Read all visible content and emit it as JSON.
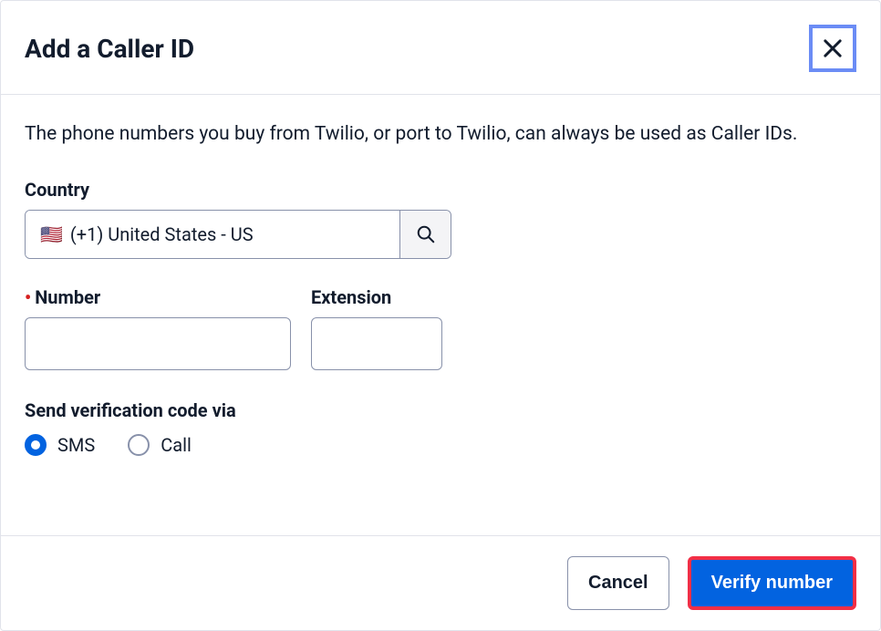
{
  "modal": {
    "title": "Add a Caller ID",
    "description": "The phone numbers you buy from Twilio, or port to Twilio, can always be used as Caller IDs."
  },
  "country": {
    "label": "Country",
    "selected_flag": "🇺🇸",
    "selected_text": "(+1) United States - US"
  },
  "number": {
    "label": "Number",
    "value": "",
    "placeholder": ""
  },
  "extension": {
    "label": "Extension",
    "value": "",
    "placeholder": ""
  },
  "verification": {
    "label": "Send verification code via",
    "options": [
      {
        "value": "sms",
        "label": "SMS",
        "checked": true
      },
      {
        "value": "call",
        "label": "Call",
        "checked": false
      }
    ]
  },
  "buttons": {
    "cancel": "Cancel",
    "verify": "Verify number"
  }
}
